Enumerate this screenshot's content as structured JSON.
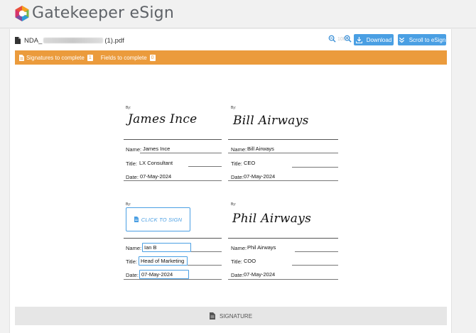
{
  "brand": {
    "name": "Gatekeeper eSign"
  },
  "file": {
    "name_prefix": "NDA_",
    "name_suffix": "(1).pdf"
  },
  "toolbar": {
    "download_label": "Download",
    "scroll_label": "Scroll to eSign",
    "zoom_level": "100"
  },
  "status": {
    "signatures_label": "Signatures to complete",
    "signatures_count": "1",
    "fields_label": "Fields to complete",
    "fields_count": "0"
  },
  "signers": [
    {
      "by": "By:",
      "signature": "James Ince",
      "name_label": "Name:",
      "name": "James Ince",
      "title_label": "Title:",
      "title": "LX Consultant",
      "date_label": "Date:",
      "date": "07-May-2024"
    },
    {
      "by": "By:",
      "signature": "Bill Airways",
      "name_label": "Name:",
      "name": "Bill Airways",
      "title_label": "Title:",
      "title": "CEO",
      "date_label": "Date:",
      "date": "07-May-2024"
    },
    {
      "by": "By:",
      "sign_button": "CLICK TO SIGN",
      "name_label": "Name:",
      "name": "Ian B",
      "title_label": "Title:",
      "title": "Head of Marketing",
      "date_label": "Date:",
      "date": "07-May-2024"
    },
    {
      "by": "By:",
      "signature": "Phil Airways",
      "name_label": "Name:",
      "name": "Phil Airways",
      "title_label": "Title:",
      "title": "COO",
      "date_label": "Date:",
      "date": "07-May-2024"
    }
  ],
  "footer": {
    "signature_label": "SIGNATURE"
  },
  "colors": {
    "accent": "#4a9fe3",
    "status_bar": "#eb9b3c"
  }
}
